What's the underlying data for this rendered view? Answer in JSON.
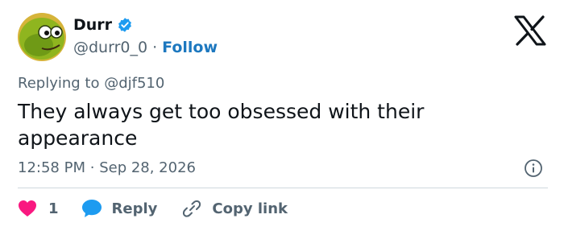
{
  "author": {
    "name": "Durr",
    "handle": "@durr0_0",
    "separator": "·",
    "follow_label": "Follow"
  },
  "reply": {
    "prefix": "Replying to",
    "mention": "@djf510"
  },
  "tweet": {
    "text": "They always get too obsessed with their appearance"
  },
  "meta": {
    "time": "12:58 PM",
    "separator": "·",
    "date": "Sep 28, 2026"
  },
  "actions": {
    "like_count": "1",
    "reply_label": "Reply",
    "copy_label": "Copy link"
  },
  "icons": {
    "verified": "verified-badge-icon",
    "logo": "x-logo-icon",
    "info": "info-icon",
    "like": "heart-icon",
    "reply": "speech-bubble-icon",
    "copy": "link-icon"
  },
  "colors": {
    "accent": "#1d9bf0",
    "follow_text": "#1d78bf",
    "like": "#f91880",
    "text": "#0f1419",
    "muted": "#536471"
  }
}
